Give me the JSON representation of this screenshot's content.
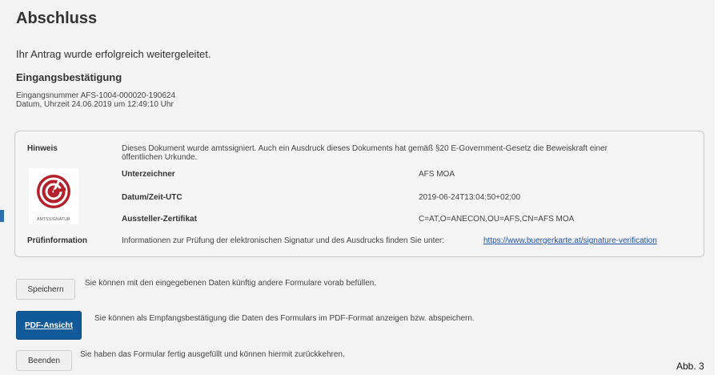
{
  "page": {
    "title": "Abschluss",
    "message": "Ihr Antrag wurde erfolgreich weitergeleitet.",
    "subtitle": "Eingangsbestätigung",
    "reference_line": "Eingangsnummer AFS-1004-000020-190624",
    "datetime_line": "Datum, Uhrzeit 24.06.2019 um 12:49:10 Uhr"
  },
  "hint": {
    "label": "Hinweis",
    "text_line1": "Dieses Dokument wurde amtssigniert. Auch ein Ausdruck dieses Dokuments hat gemäß §20 E-Government-Gesetz die Beweiskraft einer",
    "text_line2": "öffentlichen Urkunde.",
    "seal_label": "AMTSSIGNATUR",
    "fields": [
      {
        "label": "Unterzeichner",
        "value": "AFS MOA"
      },
      {
        "label": "Datum/Zeit-UTC",
        "value": "2019-06-24T13:04:50+02:00"
      },
      {
        "label": "Aussteller-Zertifikat",
        "value": "C=AT,O=ANECON,OU=AFS,CN=AFS MOA"
      }
    ],
    "pruef_label": "Prüfinformation",
    "pruef_text": "Informationen zur Prüfung der elektronischen Signatur und des Ausdrucks finden Sie unter:",
    "pruef_link": "https://www.buergerkarte.at/signature-verification"
  },
  "actions": [
    {
      "label": "Speichern",
      "text": "Sie können mit den eingegebenen Daten künftig andere Formulare vorab befüllen."
    },
    {
      "label": "PDF-Ansicht",
      "text": "Sie können als Empfangsbestätigung die Daten des Formulars im PDF-Format anzeigen bzw. abspeichern."
    },
    {
      "label": "Beenden",
      "text": "Sie haben das Formular fertig ausgefüllt und können hiermit zurückkehren."
    }
  ],
  "figure_label": "Abb. 3",
  "colors": {
    "primary_button": "#115a9a",
    "seal_red": "#b3202a",
    "link": "#1f4fa8"
  }
}
